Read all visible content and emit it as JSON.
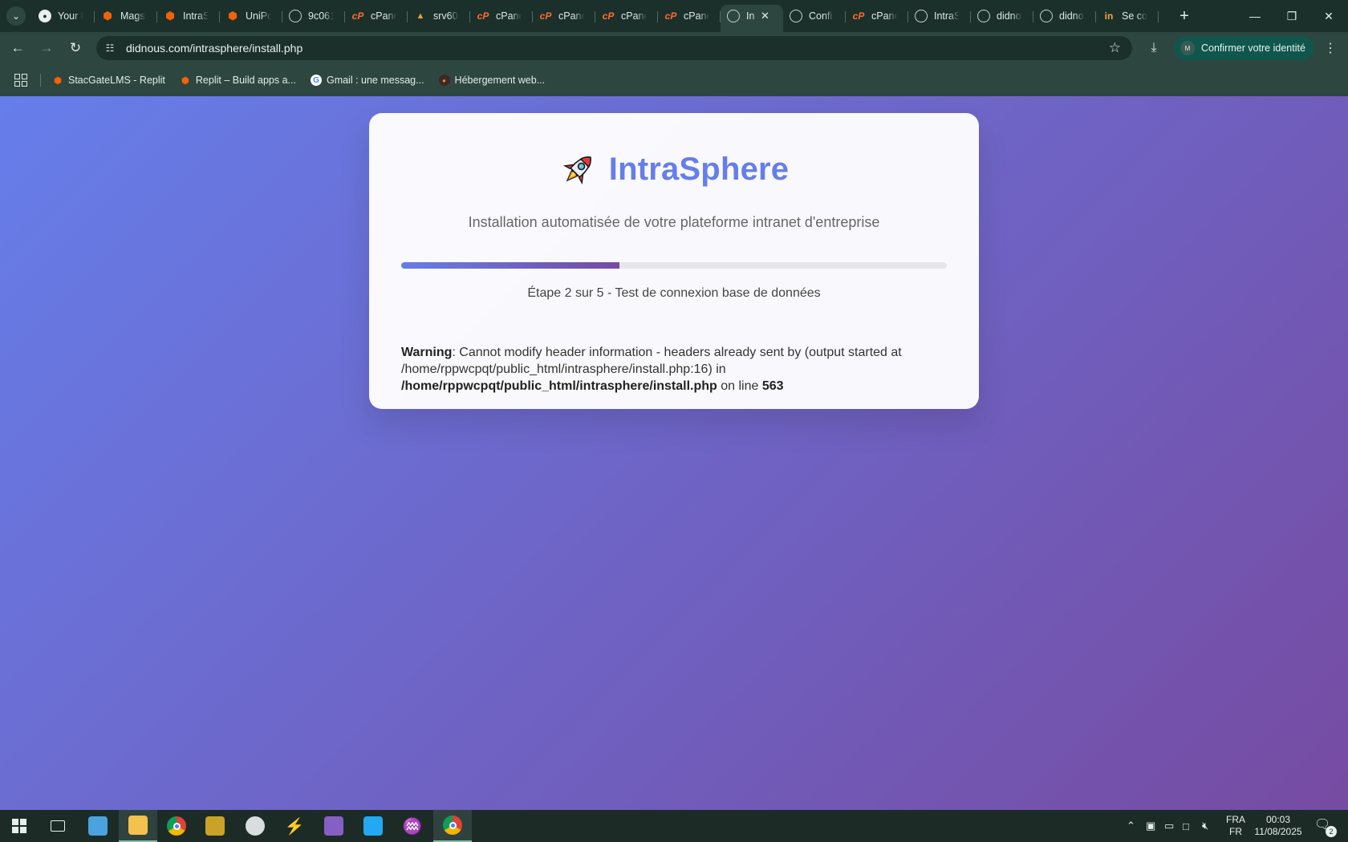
{
  "browser": {
    "tabs": [
      {
        "title": "Your R",
        "favicon": "github-icon",
        "active": false
      },
      {
        "title": "Magst",
        "favicon": "replit-icon",
        "active": false
      },
      {
        "title": "IntraS",
        "favicon": "replit-icon",
        "active": false
      },
      {
        "title": "UniPo",
        "favicon": "replit-icon",
        "active": false
      },
      {
        "title": "9c061",
        "favicon": "globe-icon",
        "active": false
      },
      {
        "title": "cPane",
        "favicon": "cpanel-icon",
        "active": false
      },
      {
        "title": "srv60",
        "favicon": "server-icon",
        "active": false
      },
      {
        "title": "cPane",
        "favicon": "cpanel-icon",
        "active": false
      },
      {
        "title": "cPane",
        "favicon": "cpanel-icon",
        "active": false
      },
      {
        "title": "cPane",
        "favicon": "cpanel-icon",
        "active": false
      },
      {
        "title": "cPane",
        "favicon": "cpanel-icon",
        "active": false
      },
      {
        "title": "In",
        "favicon": "globe-icon",
        "active": true
      },
      {
        "title": "Confi",
        "favicon": "globe-icon",
        "active": false
      },
      {
        "title": "cPane",
        "favicon": "cpanel-icon",
        "active": false
      },
      {
        "title": "IntraS",
        "favicon": "globe-icon",
        "active": false
      },
      {
        "title": "didno",
        "favicon": "globe-icon",
        "active": false
      },
      {
        "title": "didno",
        "favicon": "globe-icon",
        "active": false
      },
      {
        "title": "Se co",
        "favicon": "in-icon",
        "active": false
      }
    ],
    "url": "didnous.com/intrasphere/install.php",
    "identity_label": "Confirmer votre identité",
    "identity_avatar": "M",
    "bookmarks": [
      {
        "label": "StacGateLMS - Replit",
        "favicon": "replit-icon"
      },
      {
        "label": "Replit – Build apps a...",
        "favicon": "replit-icon"
      },
      {
        "label": "Gmail : une messag...",
        "favicon": "google-icon"
      },
      {
        "label": "Hébergement web...",
        "favicon": "hosting-icon"
      }
    ]
  },
  "page": {
    "brand_title": "IntraSphere",
    "brand_icon": "rocket-icon",
    "subtitle": "Installation automatisée de votre plateforme intranet d'entreprise",
    "progress_fraction": 0.4,
    "step_text": "Étape 2 sur 5 - Test de connexion base de données",
    "warning": {
      "label": "Warning",
      "message": ": Cannot modify header information - headers already sent by (output started at /home/rppwcpqt/public_html/intrasphere/install.php:16) in ",
      "file": "/home/rppwcpqt/public_html/intrasphere/install.php",
      "on_line": " on line ",
      "line": "563"
    }
  },
  "colors": {
    "gradient_start": "#667eea",
    "gradient_end": "#764ba2",
    "browser_chrome": "#2e4640"
  },
  "taskbar": {
    "language_top": "FRA",
    "language_bottom": "FR",
    "time": "00:03",
    "date": "11/08/2025",
    "notification_count": "2"
  }
}
